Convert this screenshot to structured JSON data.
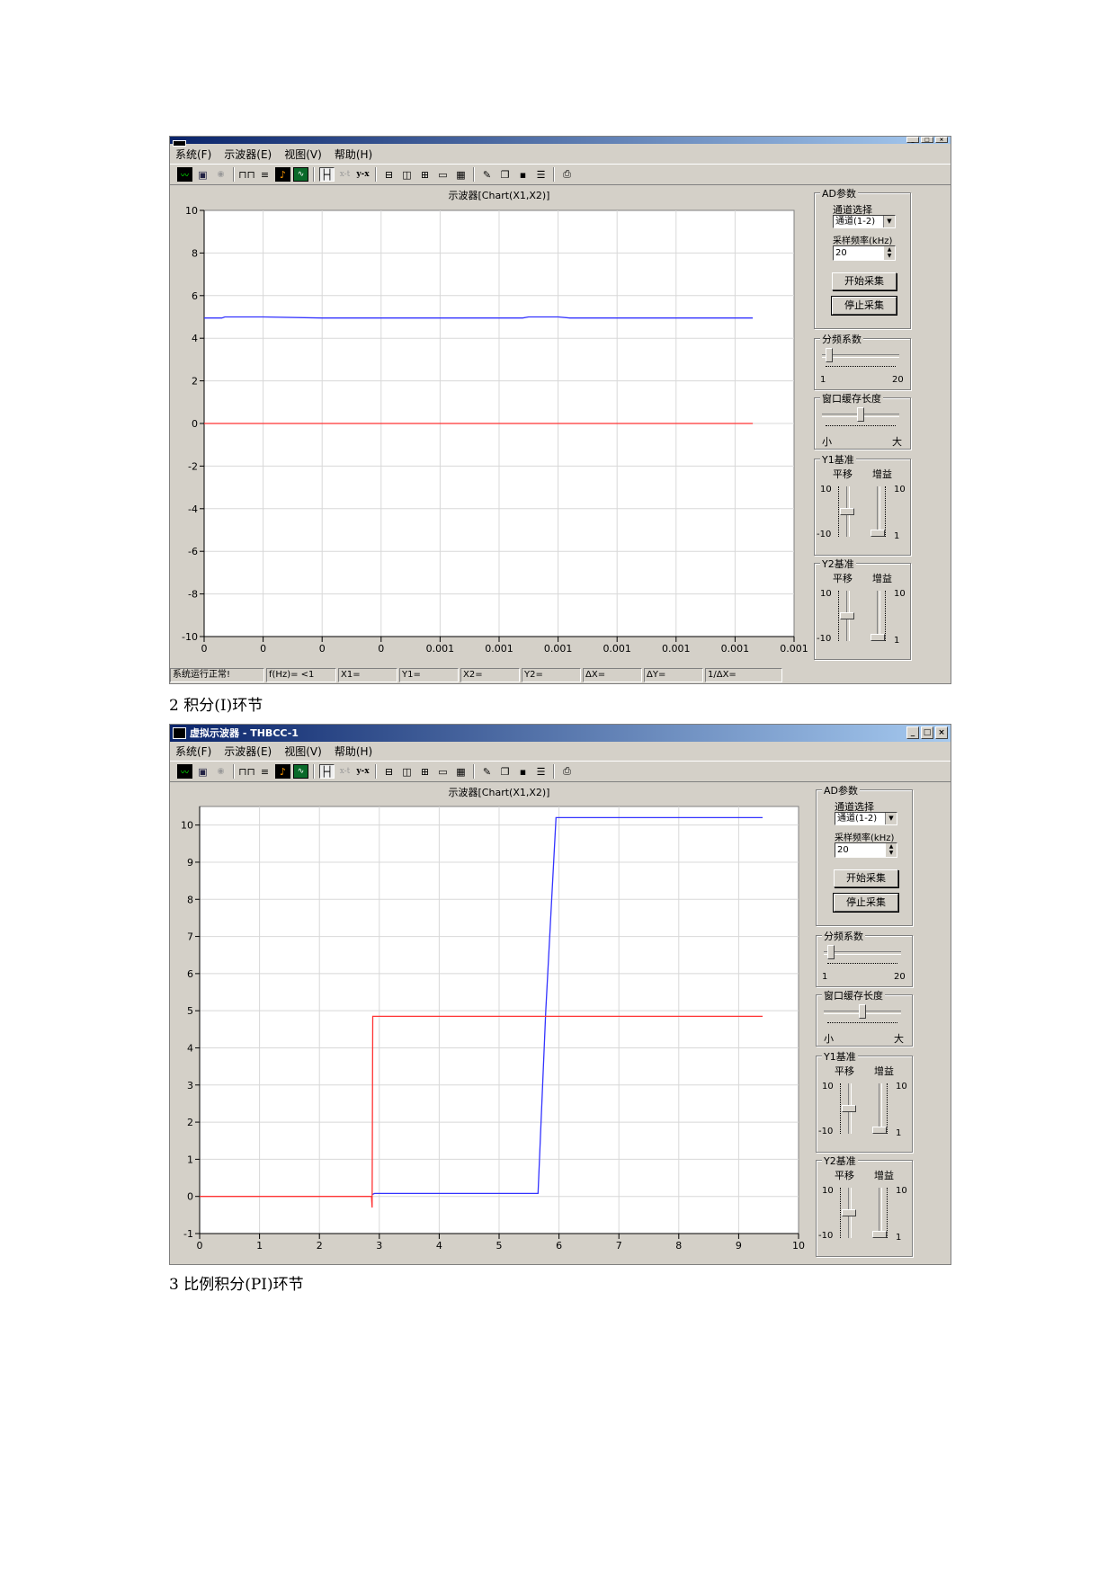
{
  "window": {
    "title": "虚拟示波器 - THBCC-1",
    "minimize": "_",
    "maximize": "□",
    "close": "×"
  },
  "menu": {
    "items": [
      {
        "label": "系统(F)"
      },
      {
        "label": "示波器(E)"
      },
      {
        "label": "视图(V)"
      },
      {
        "label": "帮助(H)"
      }
    ]
  },
  "toolbar": {
    "icons": [
      "chart-icon",
      "camera-icon",
      "record-icon",
      "square-wave-icon",
      "lines-icon",
      "fft-icon",
      "scope-icon",
      "cursor-icon",
      "xt-mode-icon",
      "yx-mode-icon",
      "split-horizontal-icon",
      "split-vertical-icon",
      "grid-icon",
      "chat-icon",
      "table-icon",
      "brush-icon",
      "copy-icon",
      "save-icon",
      "properties-icon",
      "print-icon"
    ],
    "xt_label": "x-t",
    "yx_label": "y-x"
  },
  "panel": {
    "ad_group": "AD参数",
    "channel_label": "通道选择",
    "channel_value": "通道(1-2)",
    "rate_label": "采样频率(kHz)",
    "rate_value": "20",
    "start_button": "开始采集",
    "stop_button": "停止采集",
    "divider_group": "分频系数",
    "divider_min": "1",
    "divider_max": "20",
    "divider_level": 0.05,
    "buffer_group": "窗口缓存长度",
    "buffer_min": "小",
    "buffer_max": "大",
    "buffer_level": 0.5,
    "y1_group": "Y1基准",
    "y2_group": "Y2基准",
    "shift_label": "平移",
    "gain_label": "增益",
    "shift_max": "10",
    "shift_min": "-10",
    "gain_max": "10",
    "gain_min": "1"
  },
  "status": {
    "cells": [
      "系统运行正常!",
      "f(Hz)= <1",
      "X1=",
      "Y1=",
      "X2=",
      "Y2=",
      "ΔX=",
      "ΔY=",
      "1/ΔX="
    ]
  },
  "captions": {
    "first": "2 积分(I)环节",
    "second": "3 比例积分(PI)环节"
  },
  "chart_data": [
    {
      "type": "line",
      "title": "示波器[Chart(X1,X2)]",
      "xlabel": "",
      "ylabel": "",
      "grid": true,
      "ylim": [
        -10,
        10
      ],
      "x_tick_labels": [
        "0",
        "0",
        "0",
        "0",
        "0.001",
        "0.001",
        "0.001",
        "0.001",
        "0.001",
        "0.001",
        "0.001"
      ],
      "y_ticks": [
        10,
        8,
        6,
        4,
        2,
        0,
        -2,
        -4,
        -6,
        -8,
        -10
      ],
      "series": [
        {
          "color": "#3333ff",
          "x": [
            0,
            0.3,
            0.35,
            0.37,
            1,
            2,
            3,
            4,
            5,
            5.4,
            5.5,
            6,
            6.2,
            8,
            9.3
          ],
          "y": [
            4.95,
            4.95,
            5.0,
            5.0,
            5.0,
            4.95,
            4.95,
            4.95,
            4.95,
            4.95,
            5.0,
            5.0,
            4.95,
            4.95,
            4.95
          ]
        },
        {
          "color": "#ff3333",
          "x": [
            0,
            9.3
          ],
          "y": [
            0,
            0
          ]
        }
      ]
    },
    {
      "type": "line",
      "title": "示波器[Chart(X1,X2)]",
      "xlabel": "",
      "ylabel": "",
      "grid": true,
      "xlim": [
        0,
        10
      ],
      "ylim": [
        -1,
        10.5
      ],
      "x_tick_labels": [
        "0",
        "1",
        "2",
        "3",
        "4",
        "5",
        "6",
        "7",
        "8",
        "9",
        "10"
      ],
      "y_ticks": [
        10,
        9,
        8,
        7,
        6,
        5,
        4,
        3,
        2,
        1,
        0,
        -1
      ],
      "series": [
        {
          "color": "#3333ff",
          "x": [
            2.88,
            2.92,
            4,
            5,
            5.65,
            5.78,
            5.95,
            7,
            8,
            9.4
          ],
          "y": [
            0.05,
            0.08,
            0.08,
            0.08,
            0.08,
            5.0,
            10.2,
            10.2,
            10.2,
            10.2
          ]
        },
        {
          "color": "#ff3333",
          "x": [
            0,
            1,
            2,
            2.87,
            2.88,
            2.89,
            2.9,
            4,
            6,
            8,
            9.4
          ],
          "y": [
            0,
            0,
            0,
            0,
            -0.3,
            4.85,
            4.85,
            4.85,
            4.85,
            4.85,
            4.85
          ]
        }
      ]
    }
  ]
}
